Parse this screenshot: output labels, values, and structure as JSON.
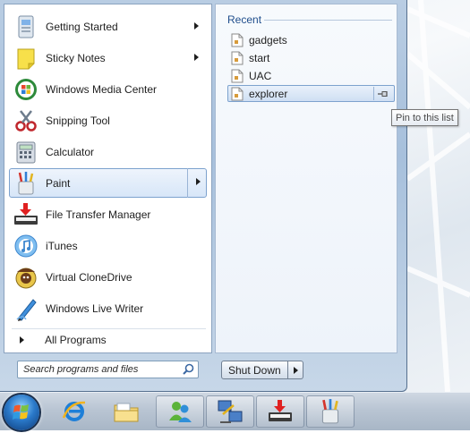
{
  "start_menu": {
    "programs": [
      {
        "label": "Getting Started",
        "icon": "getting-started-icon",
        "has_submenu": true
      },
      {
        "label": "Sticky Notes",
        "icon": "sticky-notes-icon",
        "has_submenu": true
      },
      {
        "label": "Windows Media Center",
        "icon": "media-center-icon",
        "has_submenu": false
      },
      {
        "label": "Snipping Tool",
        "icon": "scissors-icon",
        "has_submenu": false
      },
      {
        "label": "Calculator",
        "icon": "calculator-icon",
        "has_submenu": false
      },
      {
        "label": "Paint",
        "icon": "paint-icon",
        "has_submenu": true,
        "selected": true
      },
      {
        "label": "File Transfer Manager",
        "icon": "file-transfer-icon",
        "has_submenu": false
      },
      {
        "label": "iTunes",
        "icon": "itunes-icon",
        "has_submenu": false
      },
      {
        "label": "Virtual CloneDrive",
        "icon": "clonedrive-icon",
        "has_submenu": false
      },
      {
        "label": "Windows Live Writer",
        "icon": "live-writer-icon",
        "has_submenu": false
      }
    ],
    "all_programs_label": "All Programs",
    "search": {
      "placeholder": "Search programs and files",
      "value": ""
    },
    "shutdown_label": "Shut Down"
  },
  "jump_list": {
    "heading": "Recent",
    "items": [
      {
        "label": "gadgets",
        "icon": "file-icon"
      },
      {
        "label": "start",
        "icon": "file-icon"
      },
      {
        "label": "UAC",
        "icon": "file-icon"
      },
      {
        "label": "explorer",
        "icon": "file-icon",
        "selected": true
      }
    ],
    "pin_tooltip": "Pin to this list"
  },
  "taskbar": {
    "items": [
      {
        "name": "start-orb",
        "icon": "windows-logo-icon"
      },
      {
        "name": "internet-explorer",
        "icon": "ie-icon"
      },
      {
        "name": "windows-explorer",
        "icon": "folder-icon"
      },
      {
        "name": "messenger",
        "icon": "messenger-icon"
      },
      {
        "name": "network",
        "icon": "network-icon"
      },
      {
        "name": "file-transfer-manager",
        "icon": "file-transfer-icon"
      },
      {
        "name": "paint",
        "icon": "paint-icon"
      }
    ]
  },
  "colors": {
    "accent": "#1f4e8c",
    "selection_border": "#7da2ce",
    "taskbar": "#b9c5d3"
  }
}
